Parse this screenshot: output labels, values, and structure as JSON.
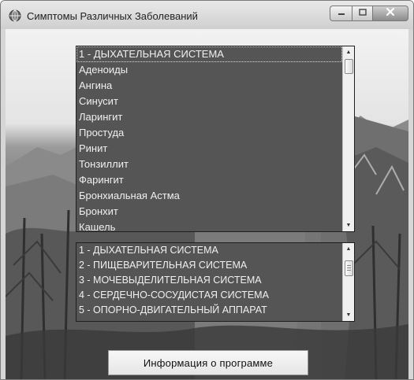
{
  "window": {
    "title": "Симптомы Различных Заболеваний",
    "icons": {
      "app": "globe-icon",
      "minimize": "minimize-icon",
      "maximize": "maximize-icon",
      "close": "close-icon"
    }
  },
  "diseases_list": {
    "items": [
      "1 - ДЫХАТЕЛЬНАЯ СИСТЕМА",
      "Аденоиды",
      "Ангина",
      "Синусит",
      "Ларингит",
      "Простуда",
      "Ринит",
      "Тонзиллит",
      "Фарингит",
      "Бронхиальная Астма",
      "Бронхит",
      "Кашель"
    ],
    "selected_index": 0
  },
  "systems_list": {
    "items": [
      "1 - ДЫХАТЕЛЬНАЯ СИСТЕМА",
      "2 - ПИЩЕВАРИТЕЛЬНАЯ СИСТЕМА",
      "3 - МОЧЕВЫДЕЛИТЕЛЬНАЯ СИСТЕМА",
      "4 - СЕРДЕЧНО-СОСУДИСТАЯ СИСТЕМА",
      "5 - ОПОРНО-ДВИГАТЕЛЬНЫЙ АППАРАТ"
    ]
  },
  "info_button": {
    "label": "Информация о программе"
  },
  "colors": {
    "list_bg": "#555555",
    "list_text": "#f0f0f0",
    "titlebar": "#dcdcdc"
  }
}
